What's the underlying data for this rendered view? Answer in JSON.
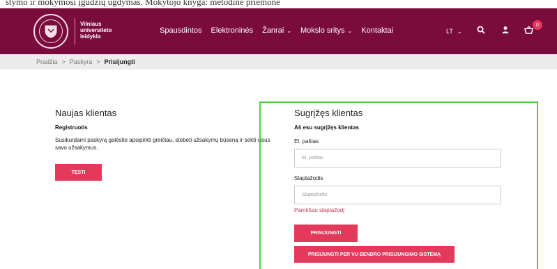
{
  "top_strip": {
    "text": "stymo ir mokymosi įgūdžių ugdymas. Mokytojo knyga: metodinė priemonė"
  },
  "logo": {
    "line1": "Vilniaus",
    "line2": "universiteto",
    "line3": "leidykla",
    "seal_text": "VILNIUS UNIVERSITAS 1579"
  },
  "nav": {
    "items": [
      {
        "label": "Spausdintos",
        "dropdown": false
      },
      {
        "label": "Elektroninės",
        "dropdown": false
      },
      {
        "label": "Žanrai",
        "dropdown": true
      },
      {
        "label": "Mokslo sritys",
        "dropdown": true
      },
      {
        "label": "Kontaktai",
        "dropdown": false
      }
    ]
  },
  "header_tools": {
    "language": "LT",
    "cart_count": "0"
  },
  "breadcrumb": {
    "items": [
      "Pradžia",
      "Paskyra"
    ],
    "separator": ">",
    "current": "Prisijungti"
  },
  "new_customer": {
    "title": "Naujas klientas",
    "subtitle": "Registruotis",
    "description": "Susikurdami paskyrą galėsite apsipirkti greičiau, stebėti užsakymų būseną ir sekti visus savo užsakymus.",
    "button": "Tęsti"
  },
  "returning_customer": {
    "title": "Sugrįžęs klientas",
    "subtitle": "Aš esu sugrįžęs klientas",
    "email_label": "El. paštas",
    "email_placeholder": "El. paštas",
    "password_label": "Slaptažodis",
    "password_placeholder": "Slaptažodis",
    "forgot_link": "Pamiršau slaptažodį",
    "login_button": "Prisijungti",
    "vu_button": "Prisijungti per VU bendro prisijungimo sistemą"
  },
  "colors": {
    "header_bg": "#7a0b3d",
    "accent": "#e33a5c",
    "highlight_border": "#49d13c"
  }
}
